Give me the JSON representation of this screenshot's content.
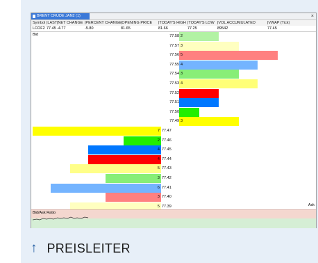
{
  "window": {
    "tab_title": "BRENT CRUDE JAN2 (1)",
    "close": "×"
  },
  "quote": {
    "headers": [
      "Symbol",
      "LAST",
      "NET CHANGE",
      "PERCENT CHANGE",
      "OPENING PRICE",
      "TODAY'S HIGH",
      "TODAY'S LOW",
      "VOL ACCUMULATED",
      "VWAP (Tick)"
    ],
    "values": [
      "LCOF2",
      "77.45",
      "-4.77",
      "-5.80",
      "81.65",
      "81.66",
      "77.25",
      "89542",
      "77.45"
    ]
  },
  "ladder": {
    "bid_label": "Bid",
    "ask_label": "Ask",
    "ask_rows": [
      {
        "price": "77.58",
        "qty": "2",
        "frac": 0.37,
        "color": "#b2f2a4"
      },
      {
        "price": "77.57",
        "qty": "3",
        "frac": 0.56,
        "color": "#ffffc0"
      },
      {
        "price": "77.56",
        "qty": "5",
        "frac": 0.93,
        "color": "#ff8080"
      },
      {
        "price": "77.55",
        "qty": "4",
        "frac": 0.74,
        "color": "#74b4ff"
      },
      {
        "price": "77.54",
        "qty": "3",
        "frac": 0.56,
        "color": "#88ee77"
      },
      {
        "price": "77.53",
        "qty": "4",
        "frac": 0.74,
        "color": "#ffff77"
      },
      {
        "price": "77.52",
        "qty": "",
        "frac": 0.37,
        "color": "#ff0000"
      },
      {
        "price": "77.51",
        "qty": "",
        "frac": 0.37,
        "color": "#0077ff"
      },
      {
        "price": "77.50",
        "qty": "",
        "frac": 0.19,
        "color": "#22ee00"
      },
      {
        "price": "77.49",
        "qty": "3",
        "frac": 0.56,
        "color": "#ffff00"
      }
    ],
    "bid_rows": [
      {
        "price": "77.47",
        "qty": "7",
        "frac": 1.0,
        "color": "#ffff00"
      },
      {
        "price": "77.46",
        "qty": "2",
        "frac": 0.29,
        "color": "#22ee00"
      },
      {
        "price": "77.45",
        "qty": "4",
        "frac": 0.57,
        "color": "#0077ff"
      },
      {
        "price": "77.44",
        "qty": "4",
        "frac": 0.57,
        "color": "#ff0000"
      },
      {
        "price": "77.43",
        "qty": "5",
        "frac": 0.71,
        "color": "#ffff88"
      },
      {
        "price": "77.42",
        "qty": "3",
        "frac": 0.43,
        "color": "#88ee77"
      },
      {
        "price": "77.41",
        "qty": "6",
        "frac": 0.86,
        "color": "#74b4ff"
      },
      {
        "price": "77.40",
        "qty": "3",
        "frac": 0.43,
        "color": "#ff8080"
      },
      {
        "price": "77.39",
        "qty": "5",
        "frac": 0.71,
        "color": "#ffffc0"
      },
      {
        "price": "77.38",
        "qty": "4",
        "frac": 0.57,
        "color": "#b2f2a4"
      }
    ]
  },
  "ratio": {
    "label": "Bid/Ask Ratio"
  },
  "footer": {
    "icon": "arrow-up-icon",
    "label": "PREISLEITER"
  }
}
